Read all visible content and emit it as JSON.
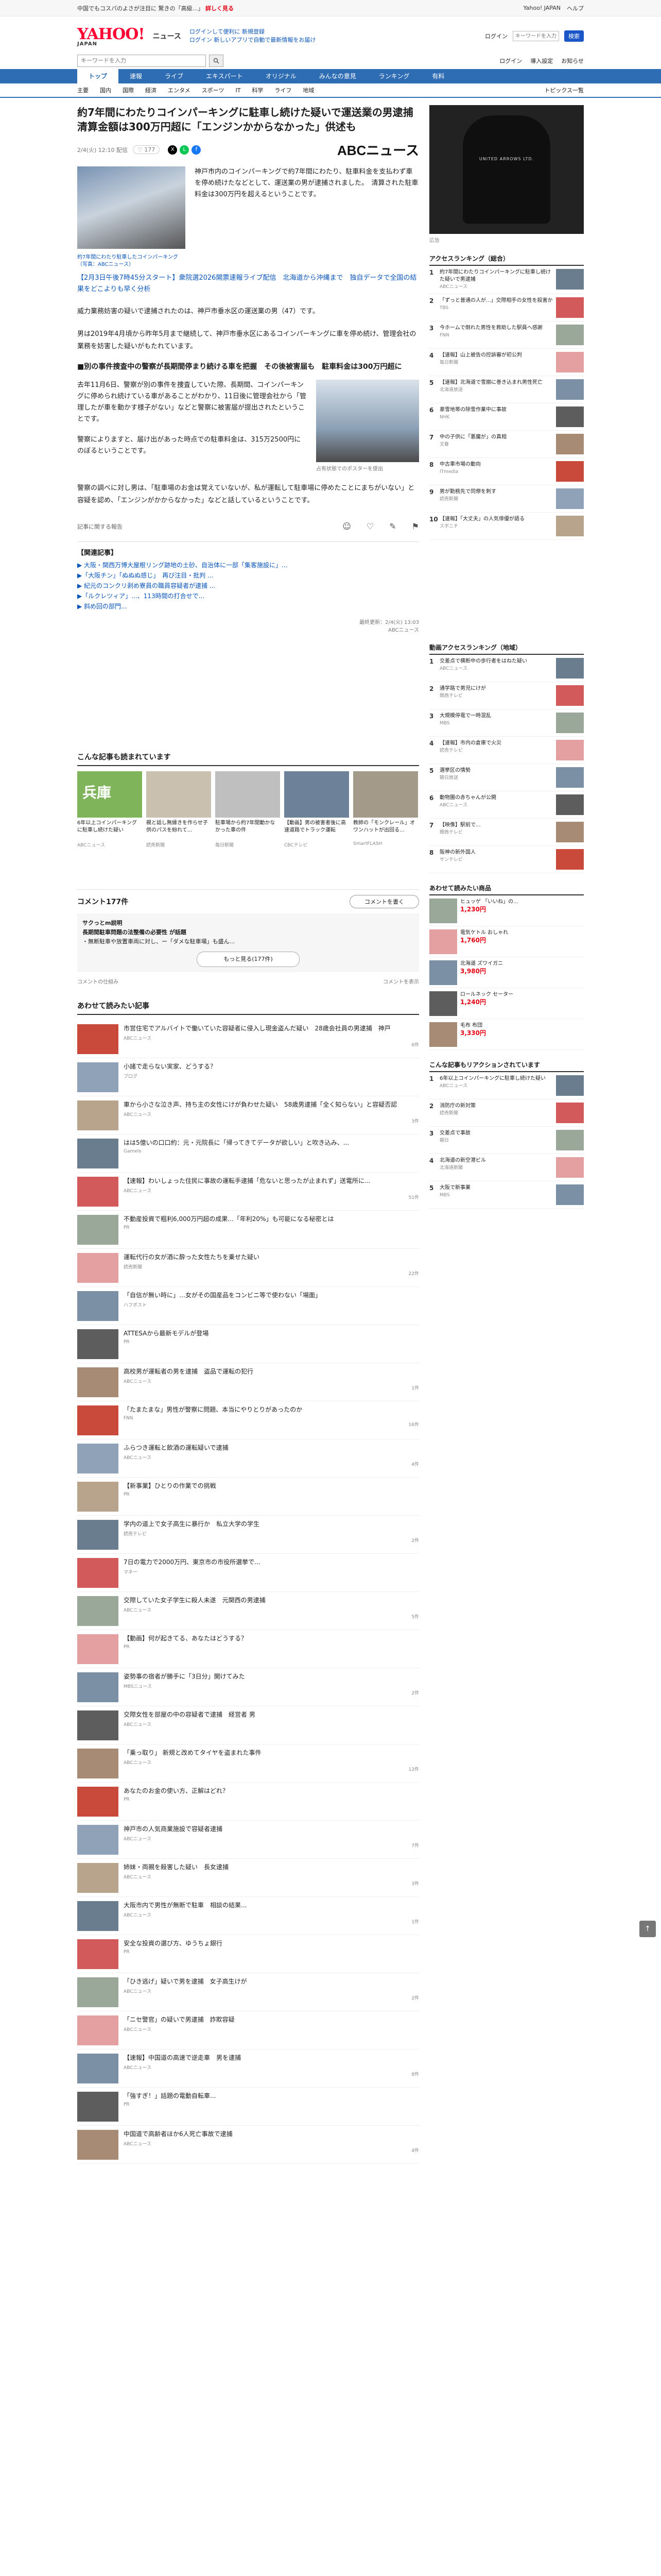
{
  "topbar": {
    "promo_prefix": "中国でもコスパのよさが注目に 驚きの「高級…」",
    "promo_link": "詳しく見る",
    "right_links": [
      "Yahoo! JAPAN",
      "ヘルプ"
    ]
  },
  "header": {
    "logo": "YAHOO!",
    "logo_sub": "JAPAN",
    "service": "ニュース",
    "links": [
      "ログインして便利に 新規登録",
      "ログイン 新しいアプリで自動で最新情報をお届け"
    ],
    "search_placeholder": "キーワードを入力",
    "login_label": "ログイン",
    "search_btn": "検索"
  },
  "search": {
    "placeholder": "キーワードを入力",
    "right_links": [
      "ログイン",
      "導入設定",
      "お知らせ"
    ]
  },
  "nav1": [
    "トップ",
    "速報",
    "ライブ",
    "エキスパート",
    "オリジナル",
    "みんなの意見",
    "ランキング",
    "有料"
  ],
  "nav1_active": 0,
  "nav2": [
    "主要",
    "国内",
    "国際",
    "経済",
    "エンタメ",
    "スポーツ",
    "IT",
    "科学",
    "ライフ",
    "地域"
  ],
  "nav2_right": "トピックス一覧",
  "article": {
    "title": "約7年間にわたりコインパーキングに駐車し続けた疑いで運送業の男逮捕　清算金額は300万円超に「エンジンかからなかった」供述も",
    "date": "2/4(火) 12:10 配信",
    "fav": "♡ 177",
    "provider": "ABCニュース",
    "lead": "神戸市内のコインパーキングで約7年間にわたり、駐車料金を支払わず車を停め続けたなどとして、運送業の男が逮捕されました。　清算された駐車料金は300万円を超えるということです。",
    "image_caption": "約7年間にわたり駐車したコインパーキング（写真：ABCニュース）",
    "inline_link": "【2月3日午後7時45分スタート】衆院選2026開票速報ライブ配信　北海道から沖縄まで　独自データで全国の結果をどこよりも早く分析",
    "p1": "威力業務妨害の疑いで逮捕されたのは、神戸市垂水区の運送業の男（47）です。",
    "p2": "男は2019年4月頃から昨年5月まで継続して、神戸市垂水区にあるコインパーキングに車を停め続け、管理会社の業務を妨害した疑いがもたれています。",
    "subhead": "■別の事件捜査中の警察が長期間停まり続ける車を把握　その後被害届も　駐車料金は300万円超に",
    "p3": "去年11月6日、警察が別の事件を捜査していた際、長期間、コインパーキングに停められ続けている車があることがわかり、11日後に管理会社から「管理したが車を動かす様子がない」などと警察に被害届が提出されたということです。",
    "p4": "警察によりますと、届け出があった時点での駐車料金は、315万2500円にのぼるということです。",
    "shop_caption": "占有状態でのポスターを提出",
    "p5": "警察の調べに対し男は、「駐車場のお金は覚えていないが、私が運転して駐車場に停めたことにまちがいない」と容疑を認め、「エンジンがかからなかった」などと話しているということです。",
    "reactions_label": "記事に関する報告",
    "react": [
      "☺",
      "♡",
      "✎",
      "⚑"
    ],
    "related_title": "【関連記事】",
    "related": [
      "▶ 大阪・関西万博大屋根リング跡地の土砂、自治体に一部「集客施設に」...",
      "▶「大阪チン」「ぬぬぬ感じ」　再び注目・批判 ...",
      "▶ 紀元のコンクリ剥め寮員の職員容疑者が逮捕 ...",
      "▶「ルクレツィア」...、113時間の打合せで...",
      "▶ 斜め回の部門..."
    ],
    "footer": "最終更新：2/4(火) 13:03\nABCニュース"
  },
  "recs_title": "こんな記事も読まれています",
  "recs": [
    {
      "title": "6年以上コインパーキングに駐車し続けた疑い",
      "src": "ABCニュース",
      "color": "#7fb45a",
      "label": "兵庫"
    },
    {
      "title": "親と話し無縁きを作らせ子供のパスを紛れて...",
      "src": "読売新聞",
      "color": "#c9c0b0",
      "label": ""
    },
    {
      "title": "駐車場から約7年間動かなかった車の件",
      "src": "毎日新聞",
      "color": "#bfbfbf",
      "label": ""
    },
    {
      "title": "【動画】男の被害者後に高速道路でトラック運転",
      "src": "CBCテレビ",
      "color": "#6d8199",
      "label": ""
    },
    {
      "title": "教師の「モンクレール」オワンハットが出回る...",
      "src": "SmartFLASH",
      "color": "#a49a8a",
      "label": ""
    }
  ],
  "comments": {
    "title": "コメント177件",
    "write_btn": "コメントを書く",
    "expert_label": "サクっとm説明",
    "expert_text": "長期間駐車問題の法整備の必要性 が話題",
    "expert_detail": "・無断駐車や放置車両に対し、ー「ダメな駐車場」も盛ん...",
    "more_btn": "もっと見る(177件)",
    "foot_left": "コメントの仕組み",
    "foot_right": "コメントを表示"
  },
  "more_title": "あわせて読みたい記事",
  "articles": [
    {
      "title": "市営住宅でアルバイトで働いていた容疑者に侵入し現金盗んだ疑い　28歳会社員の男逮捕　神戸",
      "src": "ABCニュース",
      "cnt": "6件"
    },
    {
      "title": "小諸で走らない実家、どうする？",
      "src": "ブログ",
      "cnt": ""
    },
    {
      "title": "車から小さな泣き声、持ち主の女性にけが負わせた疑い　58歳男逮捕「全く知らない」と容疑否認",
      "src": "ABCニュース",
      "cnt": "3件"
    },
    {
      "title": "はは5億いの口口約：元・元院長に「帰ってきてデータが欲しい」と吹き込み、...",
      "src": "Gamelo",
      "cnt": ""
    },
    {
      "title": "【速報】わいしょった住民に事故の運転手逮捕「危ないと思ったが止まれず」送電所に...",
      "src": "ABCニュース",
      "cnt": "51件"
    },
    {
      "title": "不動産投資で粗利6,000万円超の成果...「年利20%」も可能になる秘密とは",
      "src": "PR",
      "cnt": ""
    },
    {
      "title": "運転代行の女が酒に酔った女性たちを乗せた疑い",
      "src": "読売新聞",
      "cnt": "22件"
    },
    {
      "title": "「自信が無い時に」…女がその国産品をコンビニ等で使わない「場面」",
      "src": "ハフポスト",
      "cnt": ""
    },
    {
      "title": "ATTESAから最新モデルが登場",
      "src": "PR",
      "cnt": ""
    },
    {
      "title": "高校男が運転者の男を逮捕　盗品で運転の犯行",
      "src": "ABCニュース",
      "cnt": "1件"
    },
    {
      "title": "「たまたまな」男性が警察に問題、本当にやりとりがあったのか",
      "src": "FNN",
      "cnt": "16件"
    },
    {
      "title": "ふらつき運転と飲酒の運転疑いで逮捕",
      "src": "ABCニュース",
      "cnt": "4件"
    },
    {
      "title": "【新事業】ひとりの作業での挑戦",
      "src": "PR",
      "cnt": ""
    },
    {
      "title": "学内の道上で女子高生に暴行か　私立大学の学生",
      "src": "読売テレビ",
      "cnt": "2件"
    },
    {
      "title": "7日の電力で2000万円、東京市の市役所選挙で...",
      "src": "マネー",
      "cnt": ""
    },
    {
      "title": "交際していた女子学生に殺人未遂　元関西の男逮捕",
      "src": "ABCニュース",
      "cnt": "5件"
    },
    {
      "title": "【動画】何が起きてる、あなたはどうする？",
      "src": "PR",
      "cnt": ""
    },
    {
      "title": "姿勢事の宿者が勝手に「3日分」開けてみた",
      "src": "MBSニュース",
      "cnt": "2件"
    },
    {
      "title": "交際女性を部屋の中の容疑者で逮捕　経営者 男",
      "src": "ABCニュース",
      "cnt": ""
    },
    {
      "title": "「乗っ取り」 新規と改めてタイヤを盗まれた事件",
      "src": "ABCニュース",
      "cnt": "12件"
    },
    {
      "title": "あなたのお金の使い方、正解はどれ？",
      "src": "PR",
      "cnt": ""
    },
    {
      "title": "神戸市の人気商業施設で容疑者逮捕",
      "src": "ABCニュース",
      "cnt": "7件"
    },
    {
      "title": "姉妹・両親を殺害した疑い　長女逮捕",
      "src": "ABCニュース",
      "cnt": "3件"
    },
    {
      "title": "大阪市内で男性が無断で駐車　相談の結果...",
      "src": "ABCニュース",
      "cnt": "1件"
    },
    {
      "title": "安全な投資の選び方、ゆうちょ銀行",
      "src": "PR",
      "cnt": ""
    },
    {
      "title": "「ひき逃げ」疑いで男を逮捕　女子高生けが",
      "src": "ABCニュース",
      "cnt": "2件"
    },
    {
      "title": "「ニセ警官」の疑いで男逮捕　詐欺容疑",
      "src": "ABCニュース",
      "cnt": ""
    },
    {
      "title": "【速報】中国道の高速で逆走車　男を逮捕",
      "src": "ABCニュース",
      "cnt": "8件"
    },
    {
      "title": "「強すぎ！」話題の電動自転車...",
      "src": "PR",
      "cnt": ""
    },
    {
      "title": "中国道で高齢者ほか6人死亡事故で逮捕",
      "src": "ABCニュース",
      "cnt": "4件"
    }
  ],
  "ad": {
    "caption": "広告",
    "brand": "UNITED ARROWS LTD."
  },
  "ranking_title": "アクセスランキング（総合）",
  "ranking": [
    {
      "title": "約7年間にわたりコインパーキングに駐車し続けた疑いで男逮捕",
      "src": "ABCニュース"
    },
    {
      "title": "「ずっと普通の人が...」交際相手の女性を殺害か",
      "src": "TBS"
    },
    {
      "title": "今ホームで倒れた男性を救助した駅員へ感謝",
      "src": "FNN"
    },
    {
      "title": "【速報】山上被告の控訴審が初公判",
      "src": "毎日新聞"
    },
    {
      "title": "【速報】北海道で雪崩に巻き込まれ男性死亡",
      "src": "北海道放送"
    },
    {
      "title": "豪雪地帯の除雪作業中に事故",
      "src": "NHK"
    },
    {
      "title": "中の子供に「悪魔が」の真相",
      "src": "文春"
    },
    {
      "title": "中古車市場の動向",
      "src": "ITmedia"
    },
    {
      "title": "男が勤務先で同僚を刺す",
      "src": "読売新聞"
    },
    {
      "title": "【速報】「大丈夫」の人気俳優が語る",
      "src": "スポニチ"
    }
  ],
  "ranking2_title": "動画アクセスランキング（地域）",
  "ranking2": [
    {
      "title": "交差点で横断中の歩行者をはねた疑い",
      "src": "ABCニュース"
    },
    {
      "title": "通学路で男児にけが",
      "src": "関西テレビ"
    },
    {
      "title": "大規模停電で一時混乱",
      "src": "MBS"
    },
    {
      "title": "【速報】市内の倉庫で火災",
      "src": "読売テレビ"
    },
    {
      "title": "選挙区の情勢",
      "src": "朝日放送"
    },
    {
      "title": "動物園の赤ちゃんが公開",
      "src": "ABCニュース"
    },
    {
      "title": "【映像】駅前で...",
      "src": "関西テレビ"
    },
    {
      "title": "阪神の新外国人",
      "src": "サンテレビ"
    }
  ],
  "shop_title": "あわせて読みたい商品",
  "shop": [
    {
      "title": "ヒュッゲ 「いいね」の...",
      "price": "1,230円"
    },
    {
      "title": "電気ケトル おしゃれ",
      "price": "1,760円"
    },
    {
      "title": "北海道 ズワイガニ",
      "price": "3,980円"
    },
    {
      "title": "ロールネック セーター",
      "price": "1,240円"
    },
    {
      "title": "毛布 布団",
      "price": "3,330円"
    }
  ],
  "ranking3_title": "こんな記事もリアクションされています",
  "ranking3": [
    {
      "title": "6年以上コインパーキングに駐車し続けた疑い",
      "src": "ABCニュース"
    },
    {
      "title": "消防庁の新対策",
      "src": "読売新聞"
    },
    {
      "title": "交差点で事故",
      "src": "朝日"
    },
    {
      "title": "北海道の新空港ビル",
      "src": "北海道新聞"
    },
    {
      "title": "大阪で新事業",
      "src": "MBS"
    }
  ],
  "totop": "↑"
}
